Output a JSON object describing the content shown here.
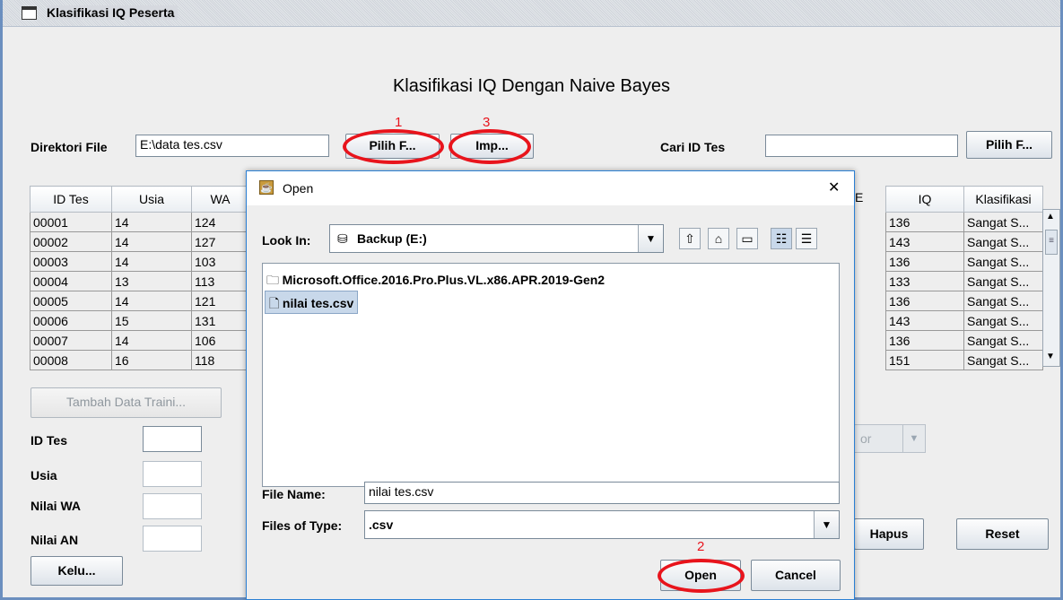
{
  "window": {
    "title": "Klasifikasi IQ Peserta"
  },
  "main": {
    "heading": "Klasifikasi IQ Dengan Naive Bayes",
    "direktori_label": "Direktori File",
    "direktori_value": "E:\\data tes.csv",
    "pilih_file_label": "Pilih F...",
    "import_label": "Imp...",
    "cari_label": "Cari ID Tes",
    "cari_value": "",
    "cari_button_label": "Pilih F...",
    "tambah_label": "Tambah Data Traini...",
    "id_tes_label": "ID Tes",
    "usia_label": "Usia",
    "nilai_wa_label": "Nilai WA",
    "nilai_an_label": "Nilai AN",
    "keluar_label": "Kelu...",
    "hapus_label": "Hapus",
    "reset_label": "Reset",
    "combo_partial": "or"
  },
  "table_left": {
    "headers": [
      "ID Tes",
      "Usia",
      "WA"
    ],
    "rows": [
      [
        "00001",
        "14",
        "124"
      ],
      [
        "00002",
        "14",
        "127"
      ],
      [
        "00003",
        "14",
        "103"
      ],
      [
        "00004",
        "13",
        "113"
      ],
      [
        "00005",
        "14",
        "121"
      ],
      [
        "00006",
        "15",
        "131"
      ],
      [
        "00007",
        "14",
        "106"
      ],
      [
        "00008",
        "16",
        "118"
      ]
    ]
  },
  "table_right": {
    "headers_partial": "E",
    "headers": [
      "IQ",
      "Klasifikasi"
    ],
    "rows": [
      [
        "136",
        "Sangat S..."
      ],
      [
        "143",
        "Sangat S..."
      ],
      [
        "136",
        "Sangat S..."
      ],
      [
        "133",
        "Sangat S..."
      ],
      [
        "136",
        "Sangat S..."
      ],
      [
        "143",
        "Sangat S..."
      ],
      [
        "136",
        "Sangat S..."
      ],
      [
        "151",
        "Sangat S..."
      ]
    ]
  },
  "annotations": {
    "one": "1",
    "two": "2",
    "three": "3",
    "color": "#e8141c"
  },
  "dialog": {
    "title": "Open",
    "look_in_label": "Look In:",
    "look_in_value": "Backup (E:)",
    "files": [
      {
        "name": "Microsoft.Office.2016.Pro.Plus.VL.x86.APR.2019-Gen2",
        "icon": "folder-icon"
      },
      {
        "name": "nilai tes.csv",
        "icon": "file-icon"
      }
    ],
    "file_name_label": "File Name:",
    "file_name_value": "nilai tes.csv",
    "files_of_type_label": "Files of Type:",
    "files_of_type_value": ".csv",
    "open_label": "Open",
    "cancel_label": "Cancel",
    "close_glyph": "✕"
  }
}
